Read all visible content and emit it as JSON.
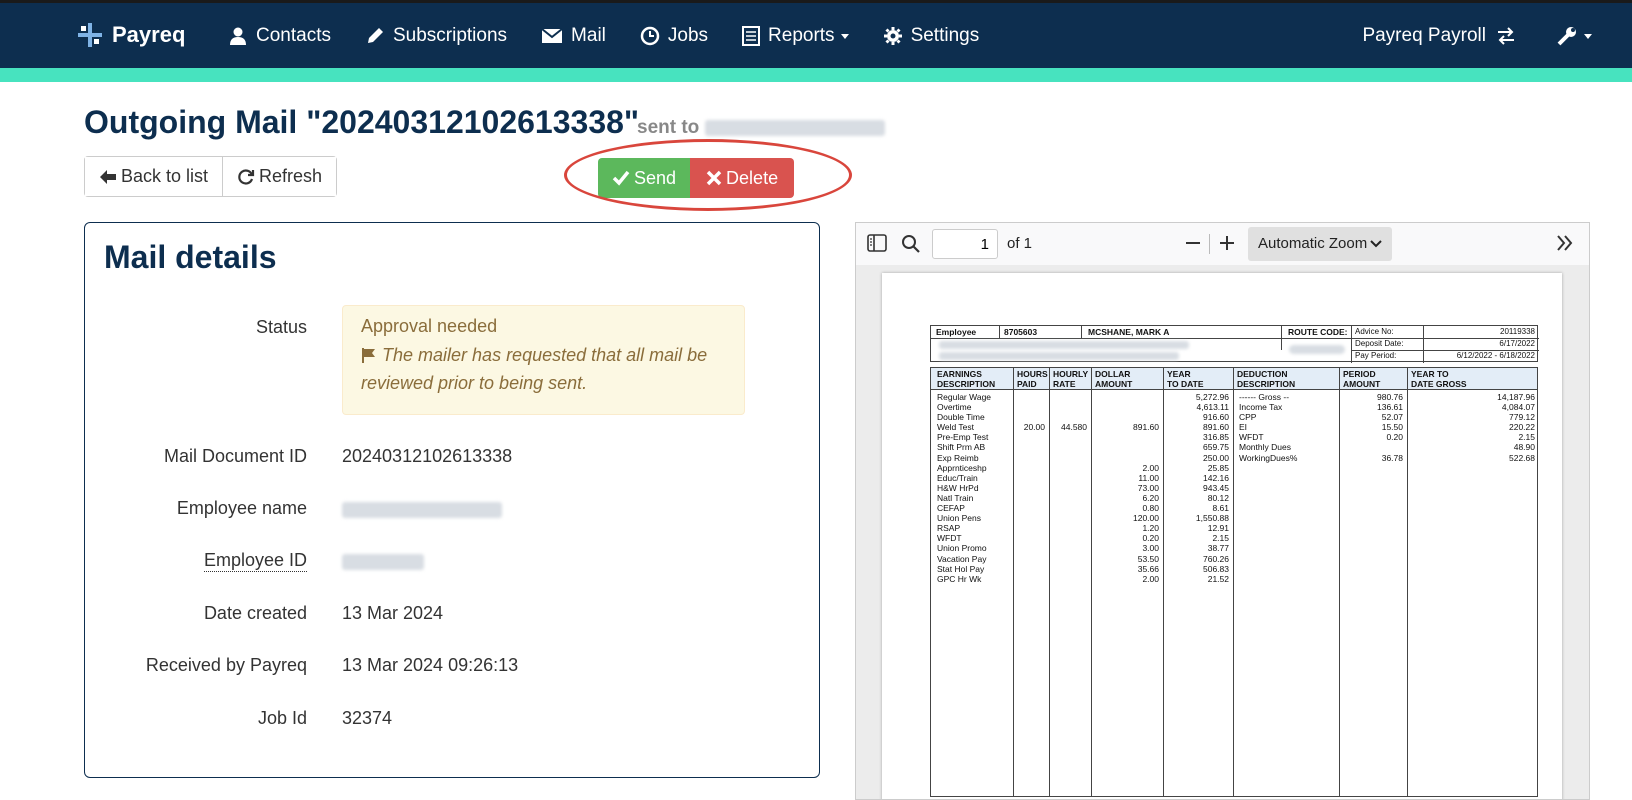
{
  "nav": {
    "brand": "Payreq",
    "items": [
      {
        "label": "Contacts",
        "icon": "user-icon"
      },
      {
        "label": "Subscriptions",
        "icon": "pencil-icon"
      },
      {
        "label": "Mail",
        "icon": "envelope-icon"
      },
      {
        "label": "Jobs",
        "icon": "clock-icon"
      },
      {
        "label": "Reports",
        "icon": "list-icon"
      },
      {
        "label": "Settings",
        "icon": "gear-icon"
      }
    ],
    "account": "Payreq Payroll"
  },
  "header": {
    "title": "Outgoing Mail \"20240312102613338\"",
    "sent_to": "sent to"
  },
  "buttons": {
    "back": "Back to list",
    "refresh": "Refresh",
    "send": "Send",
    "delete": "Delete"
  },
  "details": {
    "title": "Mail details",
    "status_label": "Status",
    "status_title": "Approval needed",
    "status_note": "The mailer has requested that all mail be reviewed prior to being sent.",
    "doc_id_label": "Mail Document ID",
    "doc_id": "20240312102613338",
    "employee_name_label": "Employee name",
    "employee_id_label": "Employee ID",
    "date_created_label": "Date created",
    "date_created": "13 Mar 2024",
    "received_label": "Received by Payreq",
    "received": "13 Mar 2024 09:26:13",
    "job_id_label": "Job Id",
    "job_id": "32374"
  },
  "viewer": {
    "page": "1",
    "of": "of 1",
    "zoom": "Automatic Zoom"
  },
  "stub": {
    "employee_label": "Employee",
    "employee_no": "8705603",
    "employee_name": "MCSHANE, MARK A",
    "route_code_label": "ROUTE CODE:",
    "advice_label": "Advice No:",
    "advice_no": "20119338",
    "deposit_label": "Deposit Date:",
    "deposit_date": "6/17/2022",
    "period_label": "Pay Period:",
    "period": "6/12/2022 - 6/18/2022",
    "headers": {
      "earnings": "EARNINGS\nDESCRIPTION",
      "hours": "HOURS\nPAID",
      "rate": "HOURLY\nRATE",
      "dollar": "DOLLAR\nAMOUNT",
      "ytd": "YEAR\nTO DATE",
      "deduction": "DEDUCTION\nDESCRIPTION",
      "period": "PERIOD\nAMOUNT",
      "ytd_gross": "YEAR TO\nDATE GROSS"
    },
    "earnings": [
      {
        "desc": "Regular Wage",
        "hours": "",
        "rate": "",
        "amount": "",
        "ytd": "5,272.96"
      },
      {
        "desc": "Overtime",
        "hours": "",
        "rate": "",
        "amount": "",
        "ytd": "4,613.11"
      },
      {
        "desc": "Double Time",
        "hours": "",
        "rate": "",
        "amount": "",
        "ytd": "916.60"
      },
      {
        "desc": "Weld Test",
        "hours": "20.00",
        "rate": "44.580",
        "amount": "891.60",
        "ytd": "891.60"
      },
      {
        "desc": "Pre-Emp Test",
        "hours": "",
        "rate": "",
        "amount": "",
        "ytd": "316.85"
      },
      {
        "desc": "Shift Prm AB",
        "hours": "",
        "rate": "",
        "amount": "",
        "ytd": "659.75"
      },
      {
        "desc": "Exp Reimb",
        "hours": "",
        "rate": "",
        "amount": "",
        "ytd": "250.00"
      },
      {
        "desc": "Apprnticeshp",
        "hours": "",
        "rate": "",
        "amount": "2.00",
        "ytd": "25.85"
      },
      {
        "desc": "Educ/Train",
        "hours": "",
        "rate": "",
        "amount": "11.00",
        "ytd": "142.16"
      },
      {
        "desc": "H&W HrPd",
        "hours": "",
        "rate": "",
        "amount": "73.00",
        "ytd": "943.45"
      },
      {
        "desc": "Natl Train",
        "hours": "",
        "rate": "",
        "amount": "6.20",
        "ytd": "80.12"
      },
      {
        "desc": "CEFAP",
        "hours": "",
        "rate": "",
        "amount": "0.80",
        "ytd": "8.61"
      },
      {
        "desc": "Union Pens",
        "hours": "",
        "rate": "",
        "amount": "120.00",
        "ytd": "1,550.88"
      },
      {
        "desc": "RSAP",
        "hours": "",
        "rate": "",
        "amount": "1.20",
        "ytd": "12.91"
      },
      {
        "desc": "WFDT",
        "hours": "",
        "rate": "",
        "amount": "0.20",
        "ytd": "2.15"
      },
      {
        "desc": "Union Promo",
        "hours": "",
        "rate": "",
        "amount": "3.00",
        "ytd": "38.77"
      },
      {
        "desc": "Vacation Pay",
        "hours": "",
        "rate": "",
        "amount": "53.50",
        "ytd": "760.26"
      },
      {
        "desc": "Stat Hol Pay",
        "hours": "",
        "rate": "",
        "amount": "35.66",
        "ytd": "506.83"
      },
      {
        "desc": "GPC Hr Wk",
        "hours": "",
        "rate": "",
        "amount": "2.00",
        "ytd": "21.52"
      }
    ],
    "deductions": [
      {
        "desc": "------ Gross --",
        "period": "980.76",
        "ytd": "14,187.96"
      },
      {
        "desc": "Income Tax",
        "period": "136.61",
        "ytd": "4,084.07"
      },
      {
        "desc": "CPP",
        "period": "52.07",
        "ytd": "779.12"
      },
      {
        "desc": "EI",
        "period": "15.50",
        "ytd": "220.22"
      },
      {
        "desc": "WFDT",
        "period": "0.20",
        "ytd": "2.15"
      },
      {
        "desc": "Monthly Dues",
        "period": "",
        "ytd": "48.90"
      },
      {
        "desc": "WorkingDues%",
        "period": "36.78",
        "ytd": "522.68"
      }
    ]
  }
}
